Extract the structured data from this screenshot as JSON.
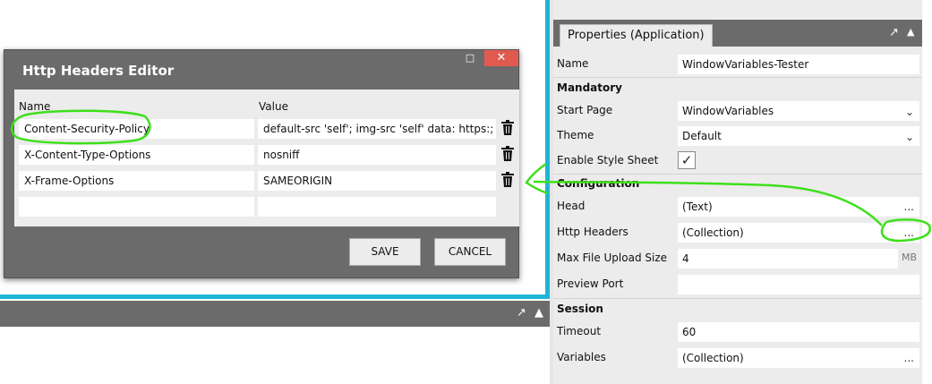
{
  "dialog": {
    "title": "Http Headers Editor",
    "minimize_glyph": "□",
    "close_glyph": "✕",
    "columns": {
      "name": "Name",
      "value": "Value"
    },
    "rows": [
      {
        "name": "Content-Security-Policy",
        "value": "default-src 'self'; img-src 'self' data: https:; script-"
      },
      {
        "name": "X-Content-Type-Options",
        "value": "nosniff"
      },
      {
        "name": "X-Frame-Options",
        "value": "SAMEORIGIN"
      },
      {
        "name": "",
        "value": ""
      }
    ],
    "save_label": "SAVE",
    "cancel_label": "CANCEL"
  },
  "properties": {
    "tab_label": "Properties (Application)",
    "tab_icons": "↗ 📌",
    "name_label": "Name",
    "name_value": "WindowVariables-Tester",
    "section_mandatory": "Mandatory",
    "start_page_label": "Start Page",
    "start_page_value": "WindowVariables",
    "theme_label": "Theme",
    "theme_value": "Default",
    "enable_style_label": "Enable Style Sheet",
    "enable_style_checked": "✓",
    "section_configuration": "Configuration",
    "head_label": "Head",
    "head_value": "(Text)",
    "http_headers_label": "Http Headers",
    "http_headers_value": "(Collection)",
    "max_upload_label": "Max File Upload Size",
    "max_upload_value": "4",
    "max_upload_unit": "MB",
    "preview_port_label": "Preview Port",
    "preview_port_value": "",
    "section_session": "Session",
    "timeout_label": "Timeout",
    "timeout_value": "60",
    "variables_label": "Variables",
    "variables_value": "(Collection)",
    "ellipsis": "...",
    "chevron": "⌄"
  },
  "lower_panel": {
    "icons": "↗ 📌"
  },
  "colors": {
    "accent_cyan": "#1fb6d6",
    "annotation_green": "#3ee01a",
    "close_red": "#e05a4f",
    "panel_gray": "#6b6b6b"
  }
}
